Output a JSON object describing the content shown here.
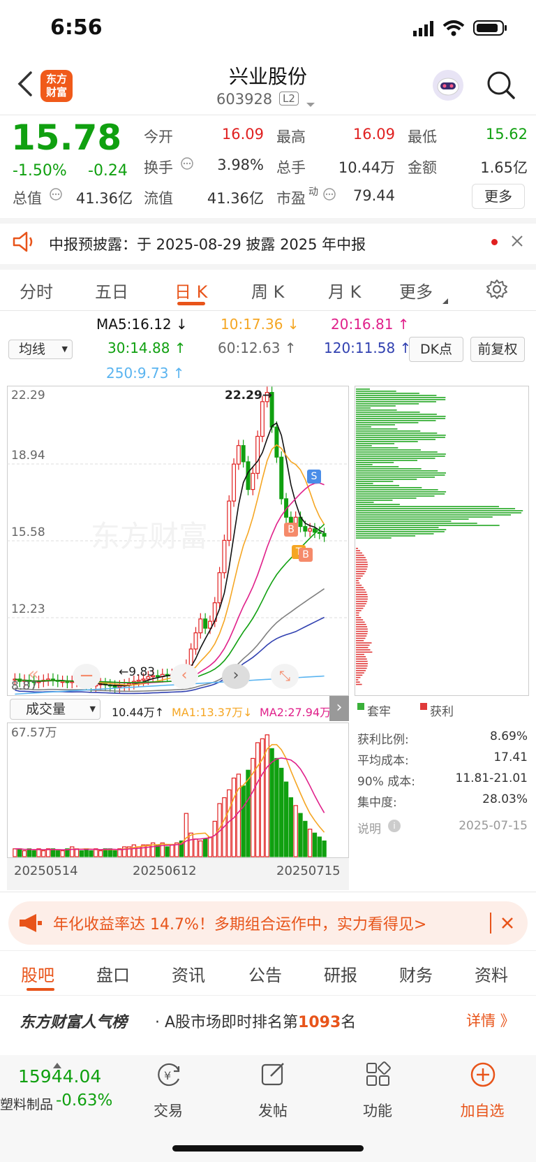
{
  "status_bar": {
    "time": "6:56"
  },
  "header": {
    "logo": "东方\n财富",
    "name": "兴业股份",
    "code": "603928",
    "level": "L2"
  },
  "quote": {
    "price": "15.78",
    "pct": "-1.50%",
    "change": "-0.24",
    "open_label": "今开",
    "open": "16.09",
    "high_label": "最高",
    "high": "16.09",
    "low_label": "最低",
    "low": "15.62",
    "turnover_label": "换手",
    "turnover": "3.98%",
    "vol_label": "总手",
    "vol": "10.44万",
    "amount_label": "金额",
    "amount": "1.65亿",
    "mktcap_label": "总值",
    "mktcap": "41.36亿",
    "float_label": "流值",
    "float": "41.36亿",
    "pe_label": "市盈",
    "pe_sup": "动",
    "pe": "79.44",
    "more": "更多"
  },
  "notice": {
    "text": "中报预披露：于 2025-08-29 披露 2025 年中报"
  },
  "tabs": [
    "分时",
    "五日",
    "日 K",
    "周 K",
    "月 K",
    "更多"
  ],
  "ma_legend": {
    "ma5": "MA5:16.12 ↓",
    "ma10": "10:17.36 ↓",
    "ma20": "20:16.81 ↑",
    "ma30": "30:14.88 ↑",
    "ma60": "60:12.63 ↑",
    "ma120": "120:11.58 ↑",
    "ma250": "250:9.73 ↑",
    "selector": "均线",
    "dk": "DK点",
    "fq": "前复权"
  },
  "colors": {
    "up": "#e02020",
    "down": "#10a010",
    "accent": "#e8541a",
    "ma5": "#111111",
    "ma10": "#f5a623",
    "ma20": "#e0208a",
    "ma30": "#10a010",
    "ma60": "#808080",
    "ma120": "#3040b0",
    "ma250": "#5ab4f0"
  },
  "chart_labels": {
    "y_ticks": [
      "22.29",
      "18.94",
      "15.58",
      "12.23",
      "8.87"
    ],
    "max_mark": "22.29→",
    "min_mark": "←9.83",
    "vol_max": "67.57万",
    "dates": [
      "20250514",
      "20250612",
      "20250715"
    ],
    "vol_selector": "成交量",
    "vol_now": "10.44万↑",
    "vol_ma1": "MA1:13.37万↓",
    "vol_ma2": "MA2:27.94万↑"
  },
  "chips": {
    "legend_hold": "套牢",
    "legend_profit": "获利",
    "stats": [
      {
        "label": "获利比例:",
        "value": "8.69%"
      },
      {
        "label": "平均成本:",
        "value": "17.41"
      },
      {
        "label": "90% 成本:",
        "value": "11.81-21.01"
      },
      {
        "label": "集中度:",
        "value": "28.03%"
      }
    ],
    "note_label": "说明",
    "note_date": "2025-07-15"
  },
  "ad": {
    "text": "年化收益率达 14.7%！多期组合运作中，实力看得见>"
  },
  "bottom_tabs": [
    "股吧",
    "盘口",
    "资讯",
    "公告",
    "研报",
    "财务",
    "资料"
  ],
  "rank": {
    "title": "东方财富人气榜",
    "text_pre": "· A股市场即时排名第",
    "num": "1093",
    "text_post": "名",
    "detail": "详情 》"
  },
  "nav": {
    "index_value": "15944.04",
    "index_name": "塑料制品",
    "index_pct": "-0.63%",
    "items": [
      "交易",
      "发帖",
      "功能",
      "加自选"
    ]
  }
}
